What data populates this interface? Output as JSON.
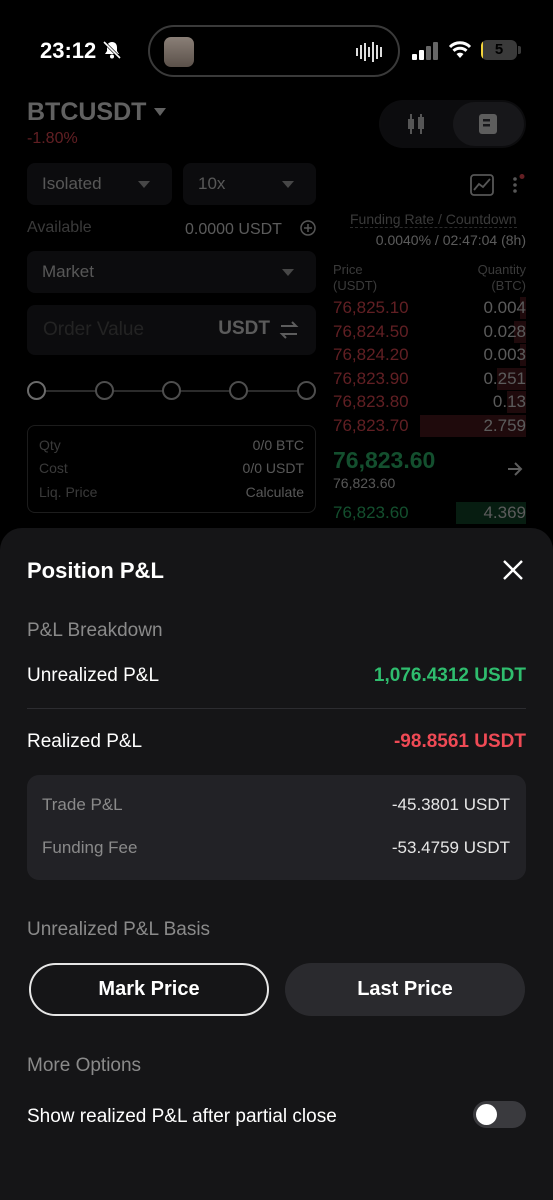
{
  "status_bar": {
    "time": "23:12",
    "battery": "5",
    "battery_level_percent": 5,
    "accent": "#f2d33a"
  },
  "trading": {
    "symbol": "BTCUSDT",
    "change": "-1.80%",
    "margin_mode": "Isolated",
    "leverage": "10x",
    "available_label": "Available",
    "available_value": "0.0000 USDT",
    "order_type": "Market",
    "order_value_placeholder": "Order Value",
    "order_currency": "USDT",
    "qty_label": "Qty",
    "qty_value": "0/0 BTC",
    "cost_label": "Cost",
    "cost_value": "0/0 USDT",
    "liq_label": "Liq. Price",
    "liq_value": "Calculate",
    "funding_label": "Funding Rate / Countdown",
    "funding_value": "0.0040% / 02:47:04 (8h)",
    "price_header": "Price (USDT)",
    "price_header_1": "Price",
    "price_header_2": "(USDT)",
    "qty_header_1": "Quantity",
    "qty_header_2": "(BTC)",
    "asks": [
      {
        "price": "76,825.10",
        "qty": "0.004",
        "depth": 0.03
      },
      {
        "price": "76,824.50",
        "qty": "0.028",
        "depth": 0.06
      },
      {
        "price": "76,824.20",
        "qty": "0.003",
        "depth": 0.03
      },
      {
        "price": "76,823.90",
        "qty": "0.251",
        "depth": 0.15
      },
      {
        "price": "76,823.80",
        "qty": "0.13",
        "depth": 0.1
      },
      {
        "price": "76,823.70",
        "qty": "2.759",
        "depth": 0.55
      }
    ],
    "last_price": "76,823.60",
    "mark_price": "76,823.60",
    "bid_price": "76,823.60",
    "bid_qty": "4.369"
  },
  "sheet": {
    "title": "Position P&L",
    "breakdown_label": "P&L Breakdown",
    "unrealized_label": "Unrealized P&L",
    "unrealized_value": "1,076.4312 USDT",
    "realized_label": "Realized P&L",
    "realized_value": "-98.8561 USDT",
    "trade_pnl_label": "Trade P&L",
    "trade_pnl_value": "-45.3801 USDT",
    "funding_fee_label": "Funding Fee",
    "funding_fee_value": "-53.4759 USDT",
    "basis_label": "Unrealized P&L Basis",
    "mark_price_button": "Mark Price",
    "last_price_button": "Last Price",
    "more_options_label": "More Options",
    "show_realized_label": "Show realized P&L after partial close",
    "show_realized_enabled": false
  },
  "colors": {
    "green": "#2fbd6e",
    "red": "#ef4a55",
    "sheet_bg": "#151517"
  }
}
